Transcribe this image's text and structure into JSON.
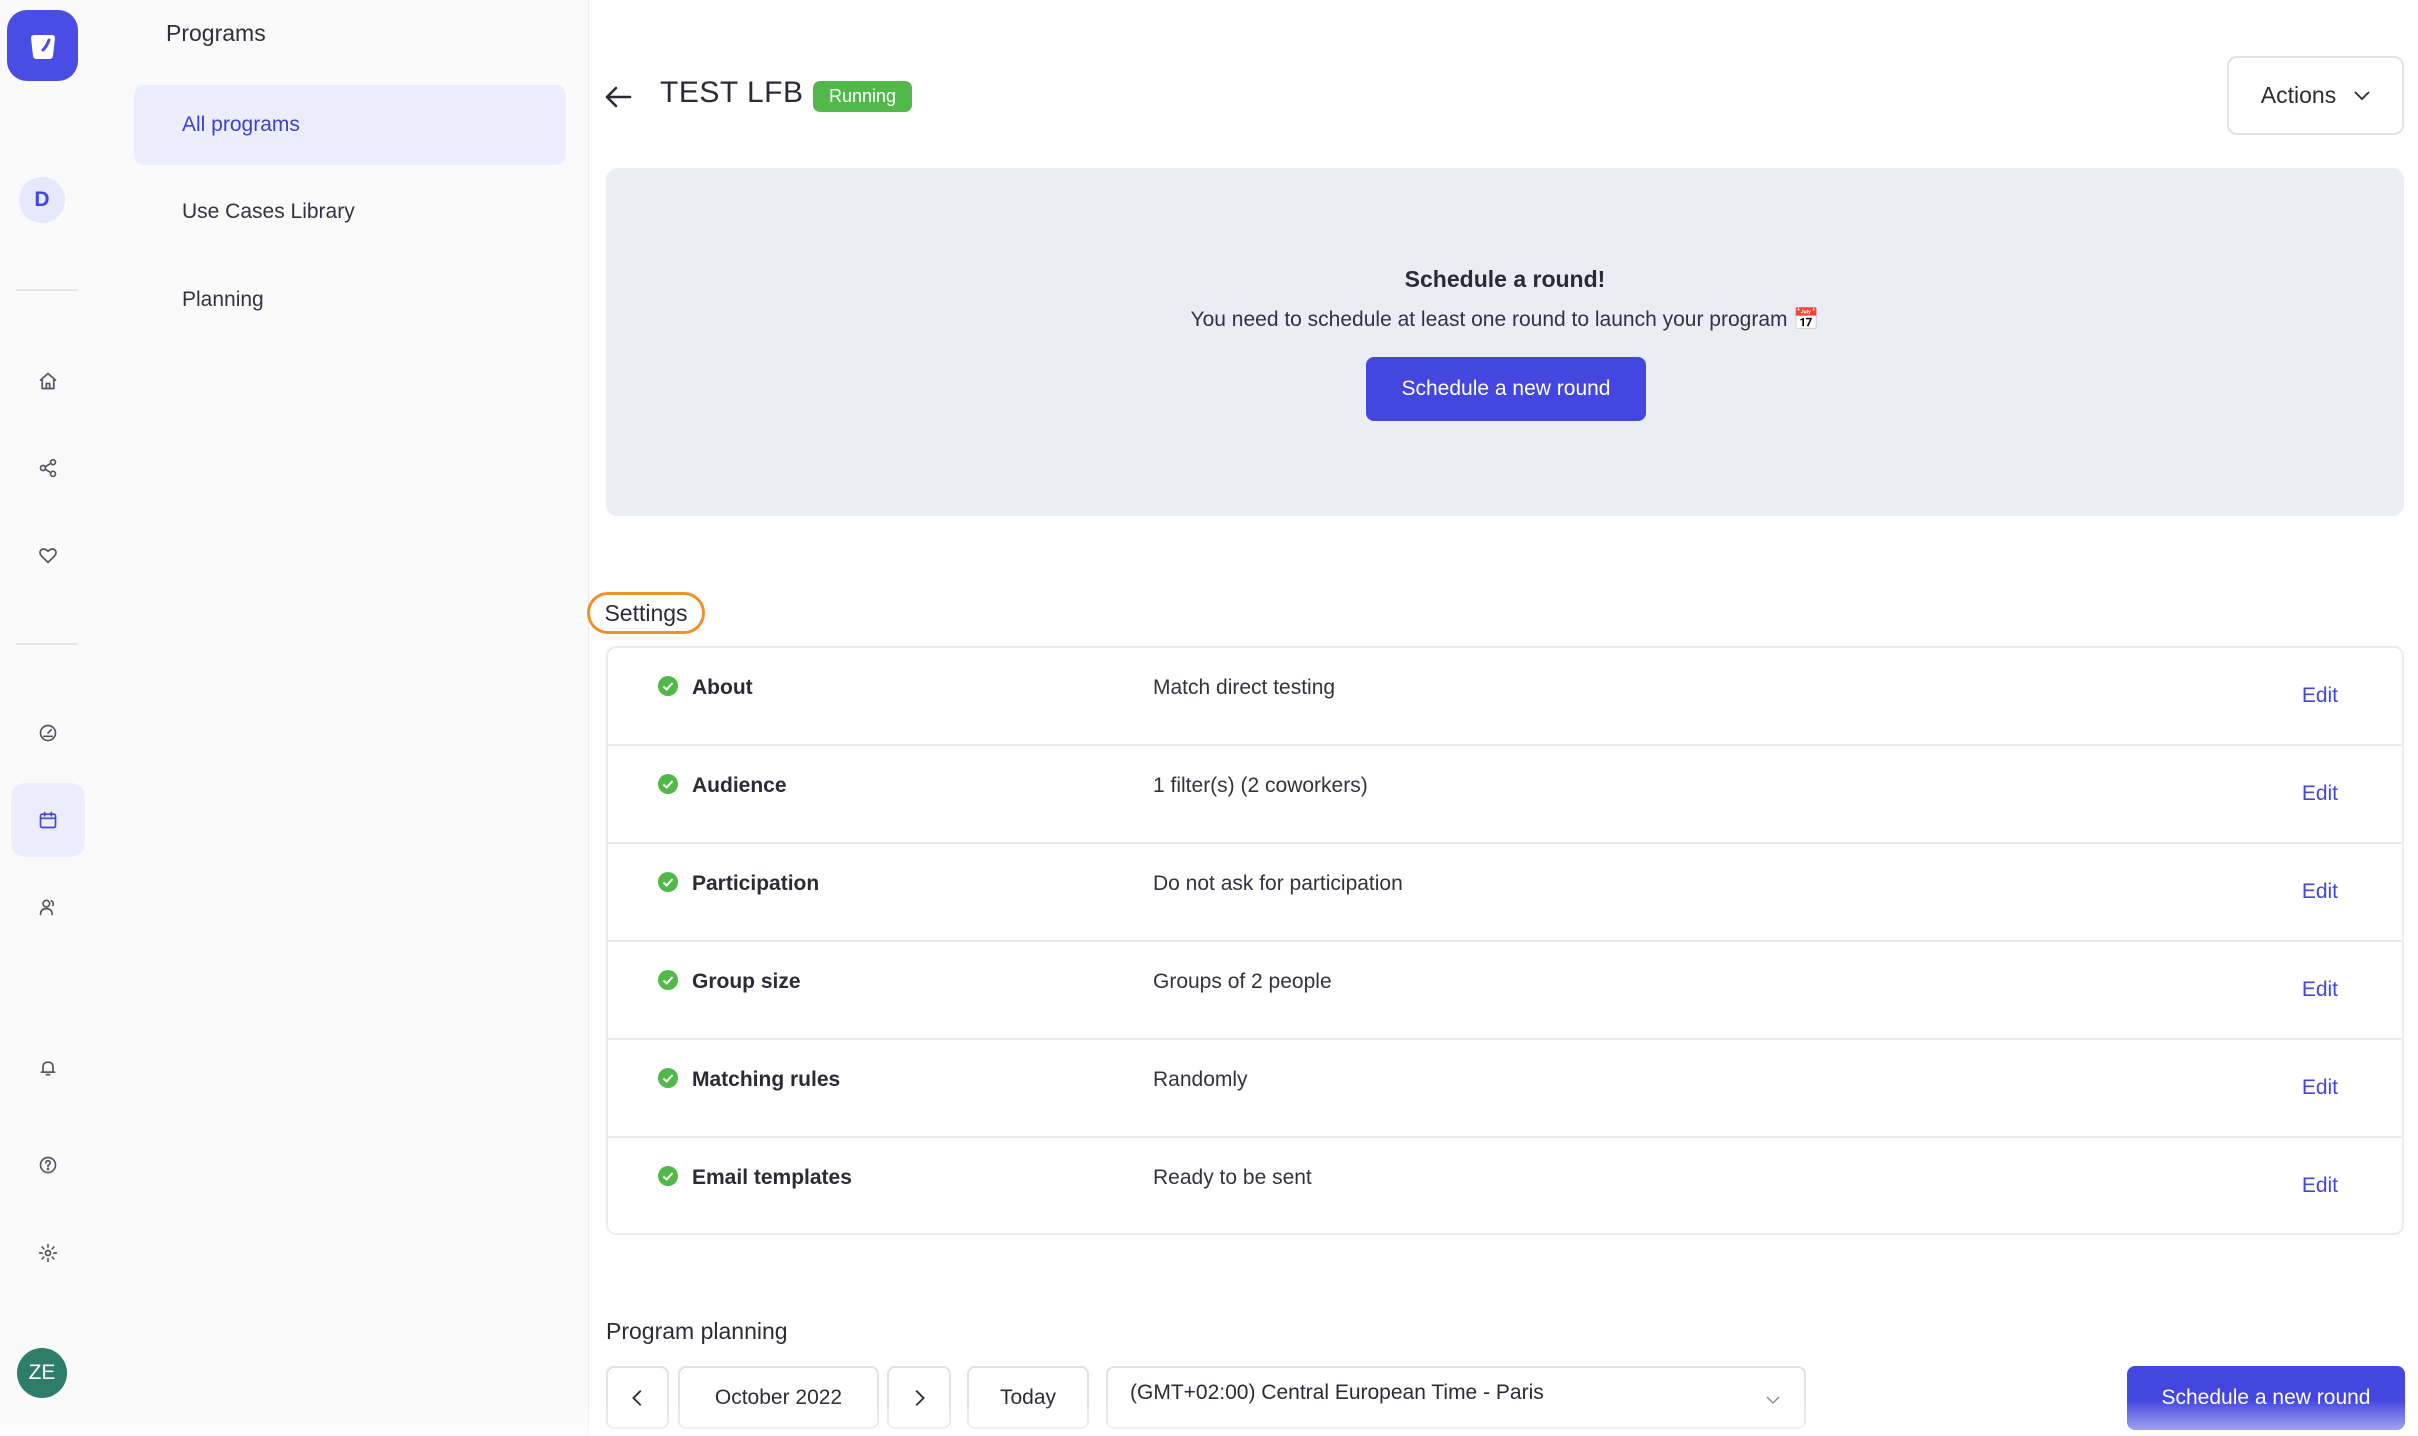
{
  "rail": {
    "workspace_initial": "D",
    "user_initials": "ZE",
    "icons": [
      "home-icon",
      "share-icon",
      "heart-icon",
      "gauge-icon",
      "calendar-icon",
      "people-icon",
      "bell-icon",
      "help-icon",
      "settings-icon"
    ]
  },
  "panel": {
    "title": "Programs",
    "items": [
      {
        "label": "All programs",
        "active": true
      },
      {
        "label": "Use Cases Library",
        "active": false
      },
      {
        "label": "Planning",
        "active": false
      }
    ]
  },
  "header": {
    "title": "TEST LFB",
    "status": "Running",
    "actions_label": "Actions"
  },
  "banner": {
    "title": "Schedule a round!",
    "text": "You need to schedule at least one round to launch your program 📅",
    "button": "Schedule a new round"
  },
  "settings": {
    "heading": "Settings",
    "rows": [
      {
        "name": "About",
        "value": "Match direct testing",
        "edit": "Edit"
      },
      {
        "name": "Audience",
        "value": "1 filter(s) (2 coworkers)",
        "edit": "Edit"
      },
      {
        "name": "Participation",
        "value": "Do not ask for participation",
        "edit": "Edit"
      },
      {
        "name": "Group size",
        "value": "Groups of 2 people",
        "edit": "Edit"
      },
      {
        "name": "Matching rules",
        "value": "Randomly",
        "edit": "Edit"
      },
      {
        "name": "Email templates",
        "value": "Ready to be sent",
        "edit": "Edit"
      }
    ]
  },
  "planning": {
    "heading": "Program planning",
    "month": "October 2022",
    "today": "Today",
    "timezone": "(GMT+02:00) Central European Time - Paris",
    "schedule_button": "Schedule a new round"
  },
  "colors": {
    "accent": "#4347e0",
    "status_green": "#52b84a",
    "highlight_orange": "#f0922b",
    "banner_bg": "#eaedf3"
  }
}
